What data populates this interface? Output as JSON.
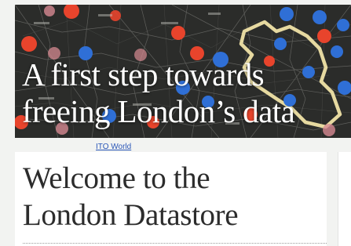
{
  "banner": {
    "headline_line1": "A first step towards",
    "headline_line2": "freeing London’s data",
    "colors": {
      "background": "#2b2c2a",
      "dot_red": "#e8442c",
      "dot_blue": "#2f6fd6",
      "dot_pink": "#d78a92",
      "boundary": "#f0e3a6"
    }
  },
  "credit": {
    "label": "ITO World"
  },
  "main": {
    "title_line1": "Welcome to the",
    "title_line2": "London Datastore"
  }
}
